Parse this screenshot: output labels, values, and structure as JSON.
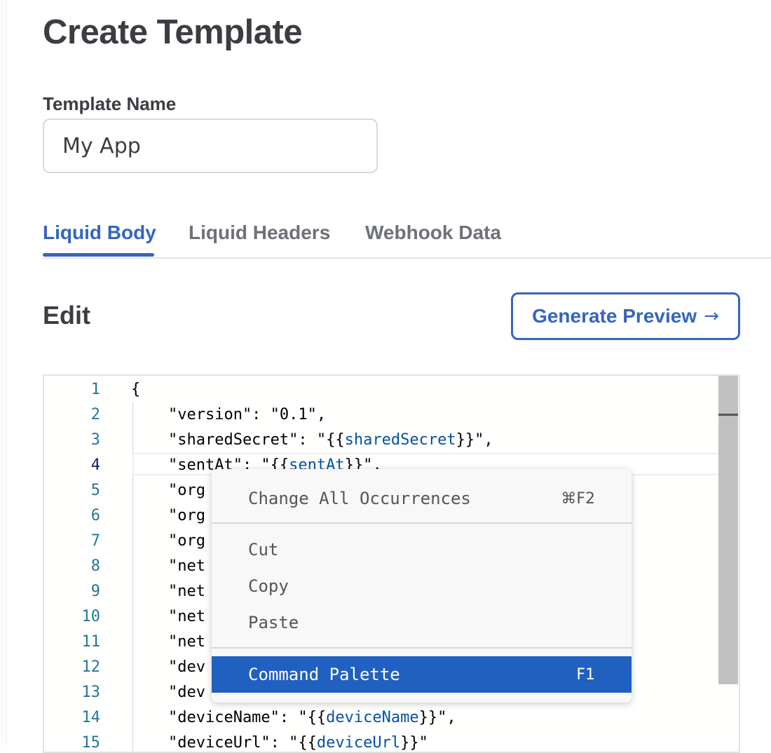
{
  "page": {
    "title": "Create Template"
  },
  "form": {
    "template_name_label": "Template Name",
    "template_name_value": "My App"
  },
  "tabs": [
    {
      "label": "Liquid Body",
      "active": true
    },
    {
      "label": "Liquid Headers",
      "active": false
    },
    {
      "label": "Webhook Data",
      "active": false
    }
  ],
  "edit": {
    "title": "Edit",
    "generate_preview_label": "Generate Preview",
    "generate_preview_icon": "arrow-right-icon"
  },
  "editor": {
    "current_line": 4,
    "line_numbers": [
      "1",
      "2",
      "3",
      "4",
      "5",
      "6",
      "7",
      "8",
      "9",
      "10",
      "11",
      "12",
      "13",
      "14",
      "15"
    ],
    "lines": [
      {
        "pre": "{",
        "var": "",
        "post": ""
      },
      {
        "pre": "    \"version\": \"0.1\",",
        "var": "",
        "post": ""
      },
      {
        "pre": "    \"sharedSecret\": \"{{",
        "var": "sharedSecret",
        "post": "}}\","
      },
      {
        "pre": "    \"sentAt\": \"{{",
        "var": "sentAt",
        "post": "}}\","
      },
      {
        "pre": "    \"org",
        "var": "",
        "post": ""
      },
      {
        "pre": "    \"org",
        "var": "",
        "post": ""
      },
      {
        "pre": "    \"org",
        "var": "",
        "post": ""
      },
      {
        "pre": "    \"net",
        "var": "",
        "post": ""
      },
      {
        "pre": "    \"net",
        "var": "",
        "post": ""
      },
      {
        "pre": "    \"net",
        "var": "",
        "post": ""
      },
      {
        "pre": "    \"net",
        "var": "",
        "post": ""
      },
      {
        "pre": "    \"dev",
        "var": "",
        "post": ""
      },
      {
        "pre": "    \"dev",
        "var": "",
        "post": ""
      },
      {
        "pre": "    \"deviceName\": \"{{",
        "var": "deviceName",
        "post": "}}\","
      },
      {
        "pre": "    \"deviceUrl\": \"{{",
        "var": "deviceUrl",
        "post": "}}\""
      }
    ]
  },
  "context_menu": {
    "items": [
      {
        "label": "Change All Occurrences",
        "shortcut": "⌘F2"
      },
      {
        "label": "Cut",
        "shortcut": ""
      },
      {
        "label": "Copy",
        "shortcut": ""
      },
      {
        "label": "Paste",
        "shortcut": ""
      },
      {
        "label": "Command Palette",
        "shortcut": "F1",
        "selected": true
      }
    ]
  },
  "colors": {
    "accent": "#3465c0",
    "menu_selected": "#2060c0",
    "line_number": "#237893",
    "liquid_variable": "#0451a5"
  }
}
